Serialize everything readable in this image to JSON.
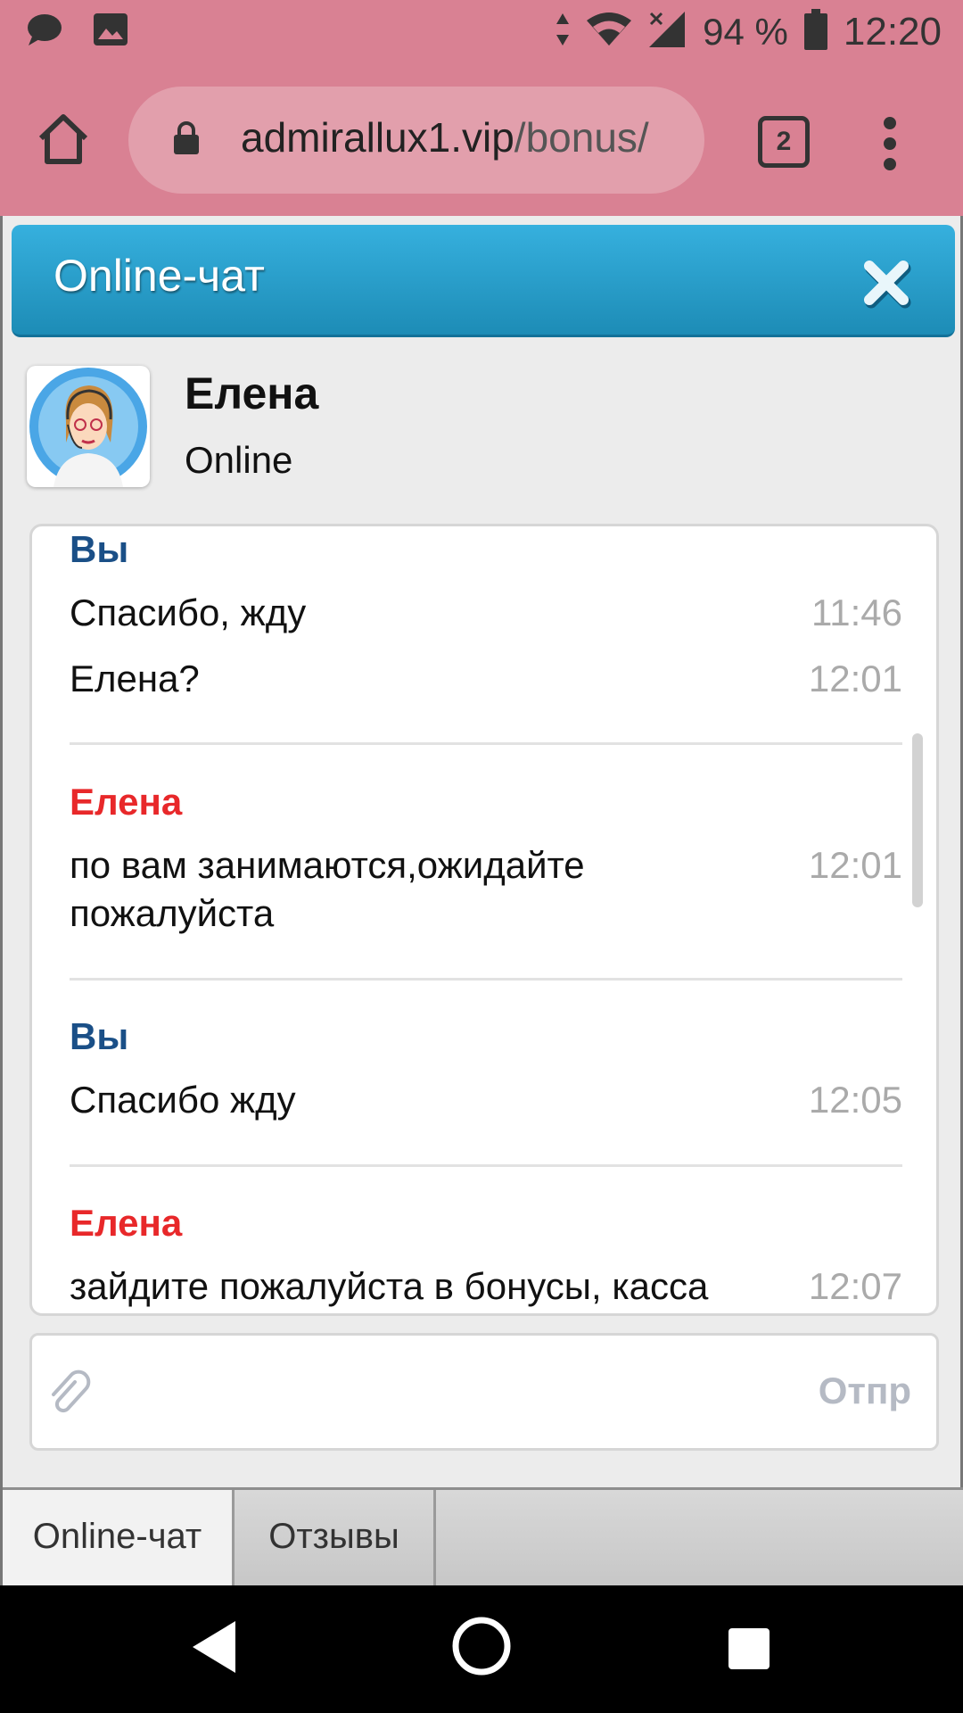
{
  "status_bar": {
    "battery_percent": "94 %",
    "time": "12:20",
    "icons": [
      "chat-bubble-icon",
      "image-icon",
      "data-arrows-icon",
      "wifi-icon",
      "no-signal-icon",
      "battery-icon"
    ]
  },
  "browser": {
    "url_host": "admirallux1.vip",
    "url_path": "/bonus/",
    "tab_count": "2",
    "icons": [
      "home-icon",
      "lock-icon",
      "tabs-icon",
      "more-vert-icon"
    ]
  },
  "chat": {
    "title": "Online-чат",
    "operator": {
      "name": "Елена",
      "status": "Online"
    },
    "messages": [
      {
        "sender": "Вы",
        "role": "you",
        "lines": [
          {
            "text": "Спасибо, жду",
            "time": "11:46"
          },
          {
            "text": "Елена?",
            "time": "12:01"
          }
        ]
      },
      {
        "sender": "Елена",
        "role": "operator",
        "lines": [
          {
            "text": "по вам занимаются,ожидайте пожалуйста",
            "time": "12:01"
          }
        ]
      },
      {
        "sender": "Вы",
        "role": "you",
        "lines": [
          {
            "text": "Спасибо жду",
            "time": "12:05"
          }
        ]
      },
      {
        "sender": "Елена",
        "role": "operator",
        "lines": [
          {
            "text": "зайдите пожалуйста в бонусы, касса",
            "time": "12:07"
          }
        ]
      }
    ],
    "composer": {
      "send_label": "Отпр"
    },
    "tabs": [
      {
        "label": "Online-чат",
        "active": true
      },
      {
        "label": "Отзывы",
        "active": false
      }
    ]
  },
  "colors": {
    "status_bar_bg": "#d98193",
    "header_blue": "#2aa3d2",
    "you_name": "#1a4f87",
    "operator_name": "#e8282a"
  },
  "android_nav": {
    "icons": [
      "back-icon",
      "home-circle-icon",
      "recents-icon"
    ]
  }
}
